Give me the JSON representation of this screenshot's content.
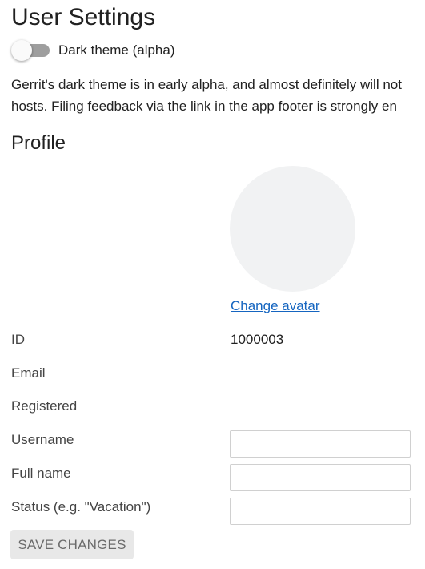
{
  "page": {
    "title": "User Settings"
  },
  "theme": {
    "toggle_label": "Dark theme (alpha)",
    "enabled": false,
    "notice_line1": "Gerrit's dark theme is in early alpha, and almost definitely will not",
    "notice_line2": "hosts. Filing feedback via the link in the app footer is strongly en"
  },
  "profile": {
    "heading": "Profile",
    "change_avatar_label": "Change avatar",
    "fields": {
      "id_label": "ID",
      "id_value": "1000003",
      "email_label": "Email",
      "email_value": "",
      "registered_label": "Registered",
      "registered_value": "",
      "username_label": "Username",
      "username_value": "",
      "fullname_label": "Full name",
      "fullname_value": "",
      "status_label": "Status (e.g. \"Vacation\")",
      "status_value": ""
    },
    "save_label": "SAVE CHANGES"
  }
}
